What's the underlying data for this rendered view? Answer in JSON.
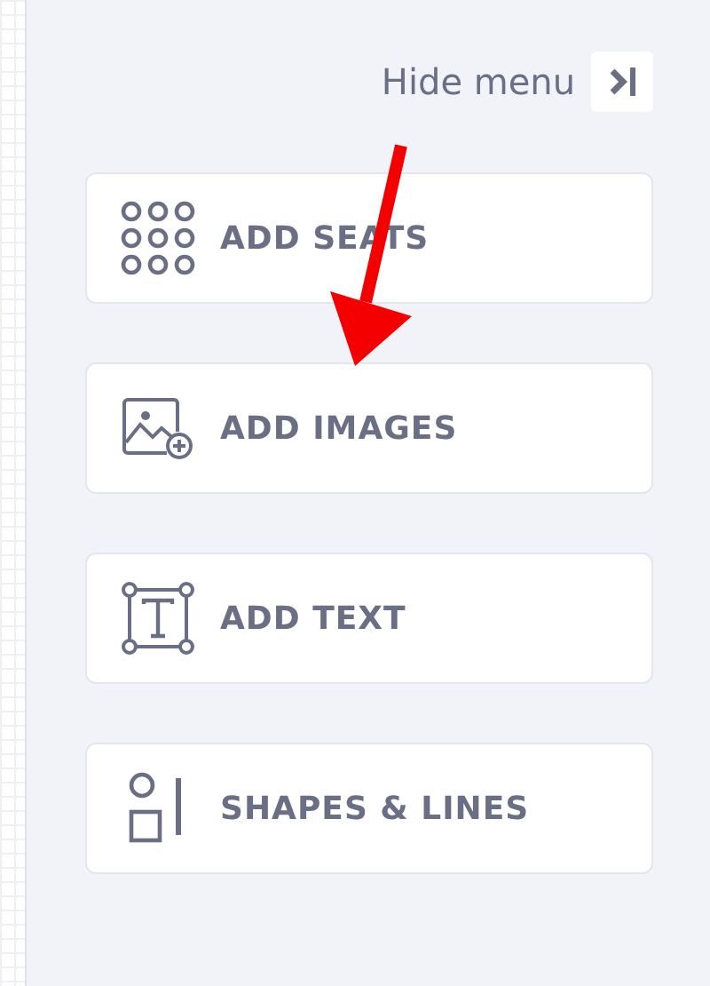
{
  "hide_menu": {
    "label": "Hide menu"
  },
  "tools": [
    {
      "kind": "seats",
      "label": "ADD SEATS"
    },
    {
      "kind": "images",
      "label": "ADD IMAGES"
    },
    {
      "kind": "text",
      "label": "ADD TEXT"
    },
    {
      "kind": "shapes",
      "label": "SHAPES & LINES"
    }
  ]
}
